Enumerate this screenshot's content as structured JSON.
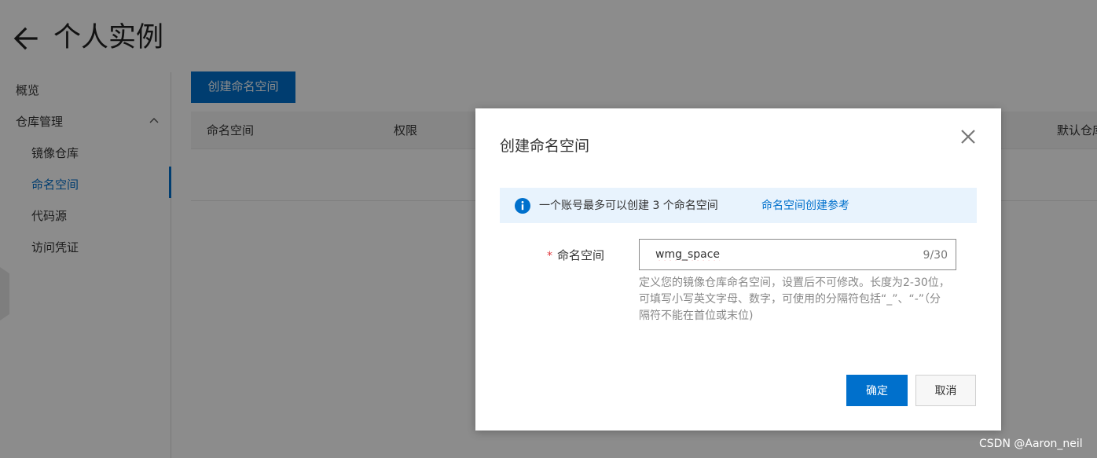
{
  "page": {
    "title": "个人实例"
  },
  "sidebar": {
    "items": [
      {
        "label": "概览"
      },
      {
        "label": "仓库管理"
      },
      {
        "label": "镜像仓库"
      },
      {
        "label": "命名空间"
      },
      {
        "label": "代码源"
      },
      {
        "label": "访问凭证"
      }
    ],
    "active": "命名空间"
  },
  "toolbar": {
    "create_label": "创建命名空间"
  },
  "table": {
    "columns": [
      "命名空间",
      "权限",
      "默认仓库"
    ]
  },
  "dialog": {
    "title": "创建命名空间",
    "notice": {
      "text": "一个账号最多可以创建 3 个命名空间",
      "link": "命名空间创建参考"
    },
    "field": {
      "required_mark": "*",
      "label": "命名空间",
      "value": "wmg_space",
      "counter": "9/30",
      "help": "定义您的镜像仓库命名空间，设置后不可修改。长度为2-30位，可填写小写英文字母、数字，可使用的分隔符包括“_”、“-”（分隔符不能在首位或末位)"
    },
    "ok_label": "确定",
    "cancel_label": "取消"
  },
  "watermark": "CSDN @Aaron_neil",
  "colors": {
    "primary": "#0070cc",
    "notice_bg": "#e8f3fd",
    "required": "#e0383e"
  }
}
